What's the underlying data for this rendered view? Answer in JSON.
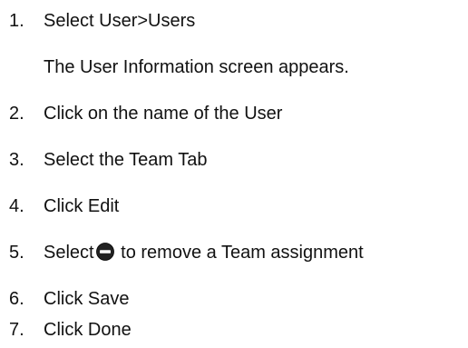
{
  "steps": [
    {
      "num": "1.",
      "text": "Select User>Users"
    },
    {
      "num": "2.",
      "text": "Click on the name of the User"
    },
    {
      "num": "3.",
      "text": "Select the Team Tab"
    },
    {
      "num": "4.",
      "text": "Click Edit"
    },
    {
      "num": "5.",
      "text_before": "Select",
      "icon": "remove-circle-icon",
      "text_after": " to remove a Team assignment"
    },
    {
      "num": "6.",
      "text": "Click Save"
    },
    {
      "num": "7.",
      "text": "Click Done"
    }
  ],
  "notes": {
    "after_step_1": "The User Information screen appears."
  },
  "colors": {
    "text": "#111111",
    "icon_fill": "#222222",
    "icon_bar": "#ffffff"
  }
}
